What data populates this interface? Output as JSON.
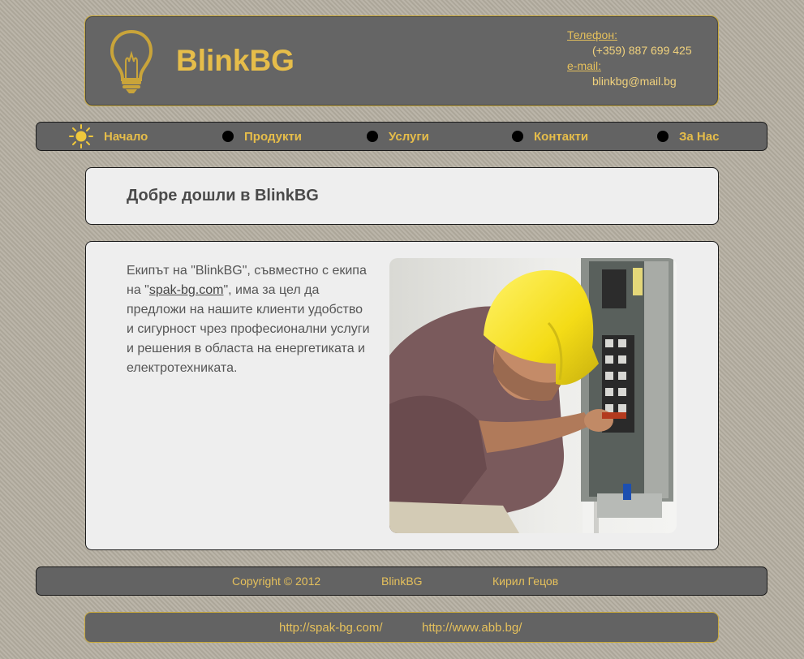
{
  "header": {
    "site_title": "BlinkBG",
    "phone_label": "Телефон:",
    "phone_value": "(+359) 887 699 425",
    "email_label": "e-mail:",
    "email_value": "blinkbg@mail.bg"
  },
  "nav": {
    "items": [
      {
        "label": "Начало",
        "icon": "sun-icon"
      },
      {
        "label": "Продукти",
        "icon": "bullet-dot-icon"
      },
      {
        "label": "Услуги",
        "icon": "bullet-dot-icon"
      },
      {
        "label": "Контакти",
        "icon": "bullet-dot-icon"
      },
      {
        "label": "За Нас",
        "icon": "bullet-dot-icon"
      }
    ]
  },
  "main": {
    "welcome_title": "Добре дошли в BlinkBG",
    "intro_part1": "Екипът на \"BlinkBG\", съвместно с екипа на \"",
    "intro_link": "spak-bg.com",
    "intro_part2": "\", има за цел да предложи на нашите клиенти удобство и сигурност чрез професионални услуги и решения в областа на енергетиката и електротехниката.",
    "photo": "electrician-with-yellow-helmet-photo"
  },
  "footer": {
    "copyright": "Copyright © 2012",
    "brand": "BlinkBG",
    "author": "Кирил Гецов"
  },
  "links": [
    "http://spak-bg.com/",
    "http://www.abb.bg/"
  ],
  "colors": {
    "accent": "#e6bd4a",
    "bar": "#636363",
    "panel": "#eeeeee",
    "background": "#b3ad9f"
  }
}
